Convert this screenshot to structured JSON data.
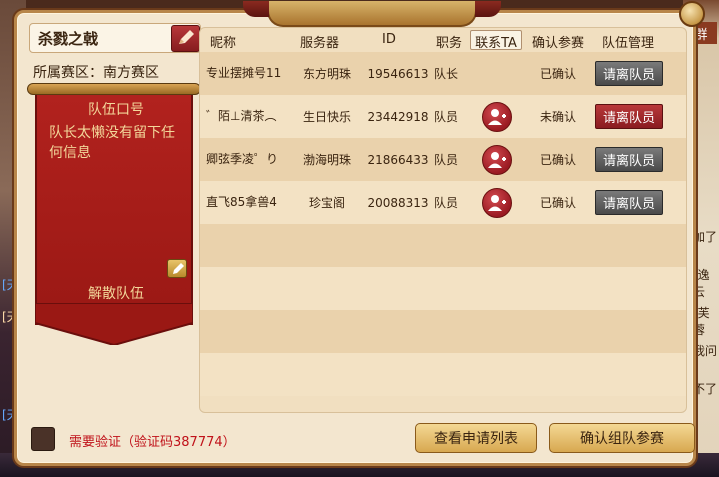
{
  "window": {
    "team_name": "杀戮之戟",
    "region_label": "所属赛区：南方赛区"
  },
  "banner": {
    "heading": "队伍口号",
    "slogan": "队长太懒没有留下任何信息",
    "disband_label": "解散队伍"
  },
  "table": {
    "headers": {
      "name": "昵称",
      "server": "服务器",
      "id": "ID",
      "role": "职务",
      "contact": "联系TA",
      "confirm": "确认参赛",
      "manage": "队伍管理"
    },
    "rows": [
      {
        "name": "专业摆摊号11",
        "server": "东方明珠",
        "id": "19546613",
        "role": "队长",
        "contact": false,
        "confirm": "已确认",
        "manage": "请离队员",
        "manage_style": "grey"
      },
      {
        "name": "゛陌⊥清茶︵",
        "server": "生日快乐",
        "id": "23442918",
        "role": "队员",
        "contact": true,
        "confirm": "未确认",
        "manage": "请离队员",
        "manage_style": "red"
      },
      {
        "name": "卿弦季凌゜り",
        "server": "渤海明珠",
        "id": "21866433",
        "role": "队员",
        "contact": true,
        "confirm": "已确认",
        "manage": "请离队员",
        "manage_style": "grey"
      },
      {
        "name": "直飞85拿兽4",
        "server": "珍宝阁",
        "id": "20088313",
        "role": "队员",
        "contact": true,
        "confirm": "已确认",
        "manage": "请离队员",
        "manage_style": "grey"
      }
    ]
  },
  "footer": {
    "verify_text": "需要验证（验证码387774）",
    "view_applications": "查看申请列表",
    "confirm_join": "确认组队参赛"
  },
  "side": {
    "right_top": "群",
    "right_items": [
      "加了",
      "[逸云",
      "[芙蓉",
      "我问",
      "不了"
    ],
    "left_items": [
      "[天",
      "[天",
      "[天"
    ]
  },
  "colors": {
    "accent_red": "#a81c1e",
    "text_dark": "#3a2410",
    "banner_text": "#f3d79a",
    "verify_red": "#c0121a"
  }
}
